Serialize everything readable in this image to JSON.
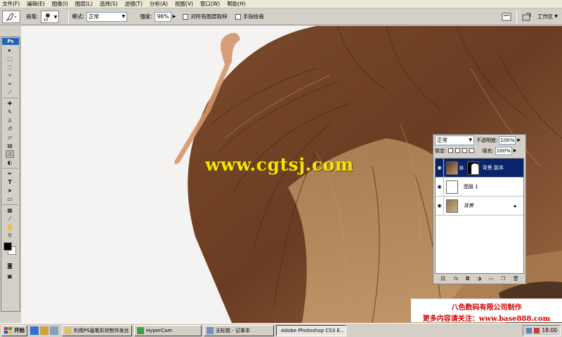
{
  "menu": [
    "文件(F)",
    "编辑(E)",
    "图像(I)",
    "图层(L)",
    "选择(S)",
    "滤镜(T)",
    "分析(A)",
    "视图(V)",
    "窗口(W)",
    "帮助(H)"
  ],
  "options": {
    "brush_label": "画笔:",
    "brush_size": "15",
    "mode_label": "模式:",
    "mode_value": "正常",
    "strength_label": "强度:",
    "strength_value": "96%",
    "sample_all_label": "对所有图层取样",
    "finger_paint_label": "手指绘画",
    "workspace_label": "工作区"
  },
  "toolbox": {
    "logo": "Ps"
  },
  "canvas": {
    "watermark": "www.cgtsj.com"
  },
  "layers_panel": {
    "blend_mode": "正常",
    "opacity_label": "不透明度:",
    "opacity_value": "100%",
    "lock_label": "锁定:",
    "fill_label": "填充:",
    "fill_value": "100%",
    "layers": [
      {
        "name": "背景 副本",
        "active": true,
        "has_mask": true
      },
      {
        "name": "图层 1",
        "active": false,
        "has_mask": false
      },
      {
        "name": "背景",
        "active": false,
        "has_mask": false,
        "locked": true
      }
    ]
  },
  "credit": {
    "line1": "八色数码有限公司制作",
    "line2": "更多内容请关注：www.base888.com"
  },
  "taskbar": {
    "start_label": "开始",
    "tasks": [
      {
        "label": "利用PS画笔形状制作发丝",
        "active": false
      },
      {
        "label": "HyperCam",
        "active": false
      },
      {
        "label": "无标题 - 记事本",
        "active": false
      },
      {
        "label": "Adobe Photoshop CS3 E...",
        "active": true
      }
    ],
    "clock": "18:00"
  }
}
